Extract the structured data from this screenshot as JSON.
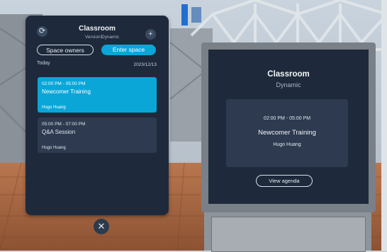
{
  "panel": {
    "title": "Classroom",
    "version": "Version1",
    "mode": "Dynamic",
    "refresh_icon": "refresh-icon",
    "add_icon": "plus-icon",
    "space_owners_label": "Space owners",
    "enter_space_label": "Enter space",
    "day_label": "Today",
    "date": "2023/12/13",
    "events": [
      {
        "time": "02:00 PM - 05:00 PM",
        "name": "Newcomer Training",
        "host": "Hugo Huang",
        "selected": true
      },
      {
        "time": "05:00 PM - 07:00 PM",
        "name": "Q&A Session",
        "host": "Hugo Huang",
        "selected": false
      }
    ],
    "close_icon": "close-icon"
  },
  "kiosk": {
    "title": "Classroom",
    "mode": "Dynamic",
    "event_time": "02:00 PM - 05:00 PM",
    "event_name": "Newcomer Training",
    "event_host": "Hugo Huang",
    "view_agenda_label": "View agenda"
  },
  "colors": {
    "panel_bg": "#1e2a3b",
    "accent": "#0aa6d8",
    "card_bg": "#2d3a4f"
  }
}
